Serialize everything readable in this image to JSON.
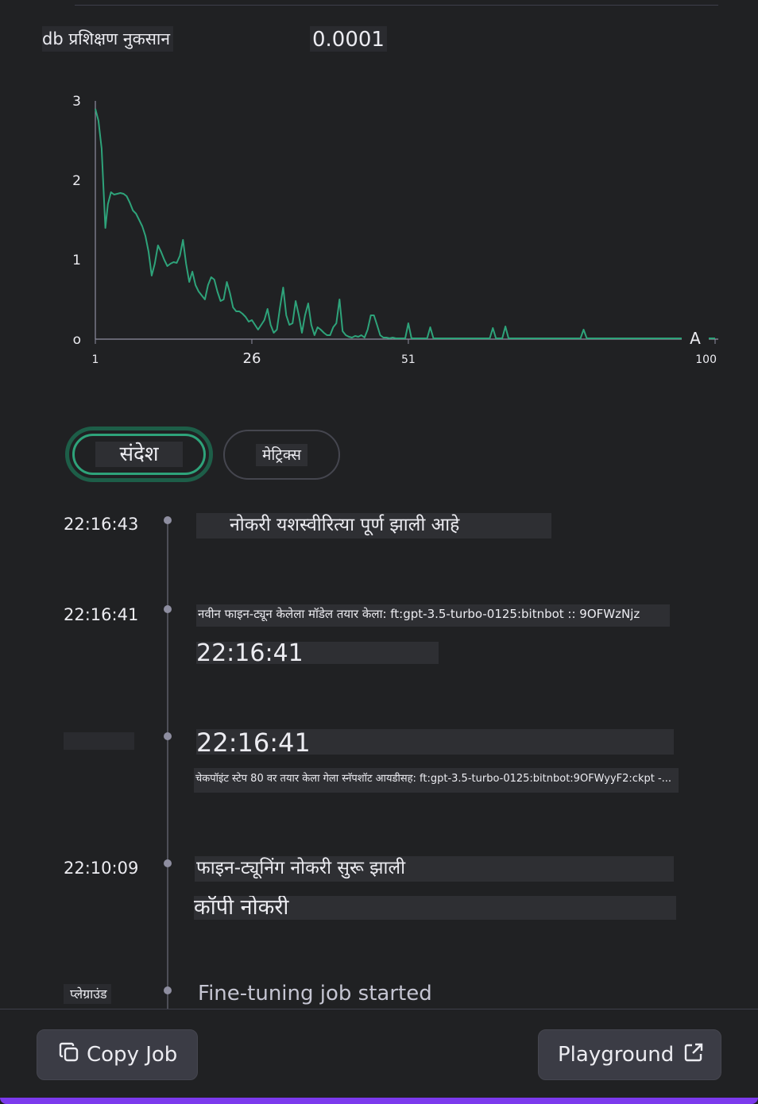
{
  "metric": {
    "label": "db प्रशिक्षण नुकसान",
    "value": "0.0001"
  },
  "chart_data": {
    "type": "line",
    "title": "",
    "xlabel": "",
    "ylabel": "",
    "xlim": [
      1,
      100
    ],
    "ylim": [
      0,
      3
    ],
    "y_ticks": [
      "3",
      "2",
      "1",
      "o"
    ],
    "x_ticks": [
      "1",
      "26",
      "51",
      "100"
    ],
    "marker_label": "A",
    "line_color": "#2ea37a",
    "series": [
      {
        "x": [
          1,
          1.5,
          2,
          2.6,
          3,
          3.5,
          4,
          4.5,
          5,
          5.5,
          6,
          6.5,
          7,
          7.5,
          8,
          8.5,
          9,
          9.5,
          10,
          10.5,
          11,
          11.5,
          12,
          12.5,
          13,
          13.5,
          14,
          14.5,
          15,
          15.5,
          16,
          16.5,
          17,
          17.5,
          18,
          18.5,
          19,
          19.5,
          20,
          20.5,
          21,
          21.5,
          22,
          22.5,
          23,
          23.5,
          24,
          24.5,
          25,
          25.5,
          26,
          26.5,
          27,
          27.5,
          28,
          28.5,
          29,
          29.5,
          30,
          30.5,
          31,
          31.5,
          32,
          32.5,
          33,
          33.5,
          34,
          34.5,
          35,
          35.5,
          36,
          36.5,
          37,
          37.5,
          38,
          38.5,
          39,
          39.5,
          40,
          40.5,
          41,
          41.5,
          42,
          42.5,
          43,
          43.5,
          44,
          44.5,
          45,
          45.5,
          46,
          46.5,
          47,
          47.5,
          48,
          48.5,
          49,
          49.5,
          50,
          50.5,
          51,
          51.5,
          52,
          52.5,
          53,
          53.5,
          54,
          54.5,
          55,
          55.5,
          56,
          56.5,
          57,
          57.5,
          58,
          58.5,
          59,
          59.5,
          60,
          60.5,
          61,
          61.5,
          62,
          62.5,
          63,
          63.5,
          64,
          64.5,
          65,
          65.5,
          66,
          66.5,
          67,
          67.5,
          68,
          68.5,
          69,
          69.5,
          70,
          70.5,
          71,
          71.5,
          72,
          72.5,
          73,
          73.5,
          74,
          74.5,
          75,
          75.5,
          76,
          76.5,
          77,
          77.5,
          78,
          78.5,
          79,
          79.5,
          80,
          80.5,
          81,
          81.5,
          82,
          82.5,
          83,
          83.5,
          84,
          84.5,
          85,
          85.5,
          86,
          86.5,
          87,
          87.5,
          88,
          88.5,
          89,
          89.5,
          90,
          90.5,
          91,
          91.5,
          92,
          92.5,
          93,
          93.5,
          94,
          94.5,
          95,
          95.5,
          96,
          96.5,
          97,
          97.5,
          98,
          98.5,
          99,
          99.5,
          100
        ],
        "y": [
          2.9,
          2.75,
          2.4,
          1.4,
          1.7,
          1.85,
          1.82,
          1.83,
          1.84,
          1.83,
          1.8,
          1.72,
          1.62,
          1.58,
          1.5,
          1.42,
          1.3,
          1.1,
          0.8,
          0.95,
          1.18,
          1.1,
          1.0,
          0.92,
          0.95,
          0.97,
          0.96,
          1.05,
          1.25,
          0.95,
          0.72,
          0.85,
          0.68,
          0.6,
          0.55,
          0.5,
          0.68,
          0.78,
          0.75,
          0.6,
          0.48,
          0.5,
          0.72,
          0.58,
          0.4,
          0.35,
          0.35,
          0.32,
          0.28,
          0.22,
          0.24,
          0.18,
          0.12,
          0.18,
          0.24,
          0.38,
          0.18,
          0.08,
          0.12,
          0.4,
          0.65,
          0.3,
          0.18,
          0.2,
          0.48,
          0.3,
          0.08,
          0.3,
          0.45,
          0.18,
          0.05,
          0.15,
          0.12,
          0.08,
          0.05,
          0.05,
          0.15,
          0.2,
          0.5,
          0.1,
          0.05,
          0.03,
          0.02,
          0.04,
          0.03,
          0.05,
          0.02,
          0.12,
          0.3,
          0.3,
          0.18,
          0.05,
          0.02,
          0.02,
          0.01,
          0.02,
          0.01,
          0.01,
          0.01,
          0.01,
          0.2,
          0.01,
          0.01,
          0.01,
          0.01,
          0.01,
          0.01,
          0.15,
          0.01,
          0.01,
          0.01,
          0.01,
          0.01,
          0.01,
          0.01,
          0.01,
          0.01,
          0.01,
          0.01,
          0.01,
          0.01,
          0.01,
          0.01,
          0.01,
          0.01,
          0.01,
          0.01,
          0.14,
          0.01,
          0.01,
          0.01,
          0.16,
          0.01,
          0.01,
          0.01,
          0.01,
          0.01,
          0.01,
          0.01,
          0.01,
          0.01,
          0.01,
          0.01,
          0.01,
          0.01,
          0.01,
          0.01,
          0.01,
          0.01,
          0.01,
          0.01,
          0.01,
          0.01,
          0.01,
          0.01,
          0.01,
          0.12,
          0.01,
          0.01,
          0.01,
          0.01,
          0.01,
          0.01,
          0.01,
          0.01,
          0.01,
          0.01,
          0.01,
          0.01,
          0.01,
          0.01,
          0.01,
          0.01,
          0.01,
          0.01,
          0.01,
          0.01,
          0.01,
          0.01,
          0.01,
          0.01,
          0.01,
          0.01,
          0.01,
          0.01,
          0.01,
          0.01,
          0.01,
          0.01,
          0.01,
          0.01,
          0.01,
          0.01,
          0.01,
          0.01,
          0.01,
          0.01,
          0.01,
          0.01
        ]
      }
    ]
  },
  "tabs": [
    {
      "label": "संदेश",
      "active": true
    },
    {
      "label": "मेट्रिक्स",
      "active": false
    }
  ],
  "events": [
    {
      "time": "22:16:43",
      "lines": [
        "नोकरी यशस्वीरित्या पूर्ण झाली आहे"
      ]
    },
    {
      "time": "22:16:41",
      "lines": [
        "नवीन फाइन-ट्यून केलेला मॉडेल तयार केला: ft:gpt-3.5-turbo-0125:bitnbot :: 9OFWzNjz",
        "22:16:41"
      ]
    },
    {
      "time": "",
      "lines": [
        "22:16:41",
        "चेकपॉइंट स्टेप 80 वर तयार केला गेला स्नॅपशॉट आयडीसह: ft:gpt-3.5-turbo-0125:bitnbot:9OFWyyF2:ckpt -..."
      ]
    },
    {
      "time": "22:10:09",
      "lines": [
        "फाइन-ट्यूनिंग नोकरी सुरू झाली",
        "कॉपी नोकरी"
      ]
    },
    {
      "time": "प्लेग्राउंड",
      "lines": [
        "Fine-tuning job started"
      ]
    }
  ],
  "footer": {
    "copy_label": "Copy Job",
    "playground_label": "Playground"
  }
}
